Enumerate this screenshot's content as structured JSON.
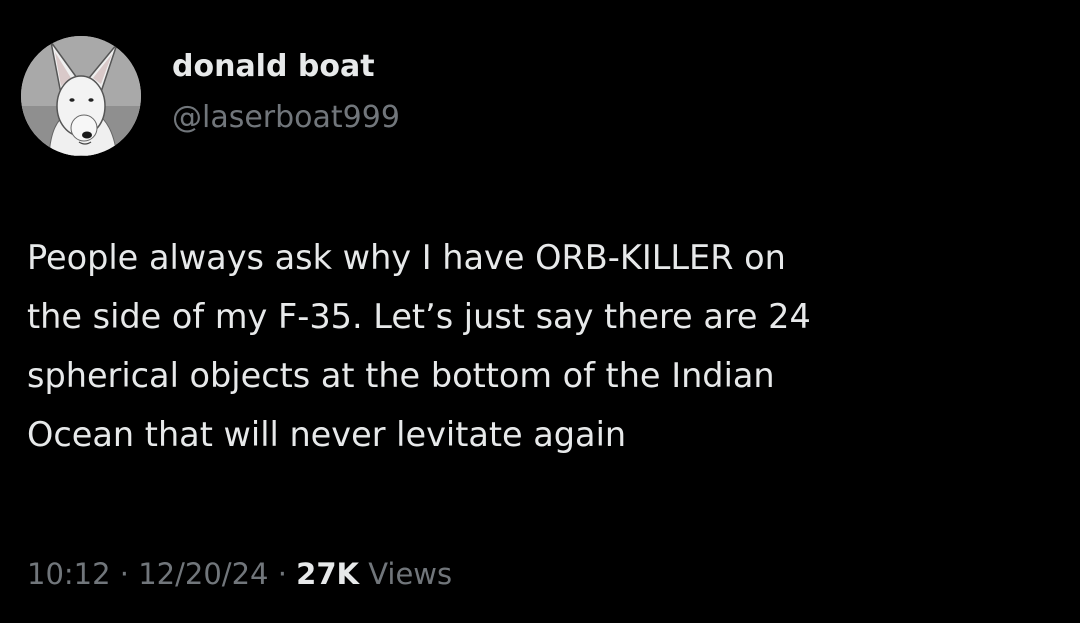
{
  "author": {
    "display_name": "donald boat",
    "handle": "@laserboat999",
    "avatar_icon": "bull-terrier-avatar-icon"
  },
  "tweet": {
    "lines": [
      "People always ask why I have ORB-KILLER on",
      "the side of my F-35. Let’s just say there are 24",
      "spherical objects at the bottom of the Indian",
      "Ocean that will never levitate again"
    ]
  },
  "meta": {
    "time": "10:12",
    "separator": " · ",
    "date": "12/20/24",
    "views_count": "27K",
    "views_label": "Views"
  },
  "colors": {
    "background": "#000000",
    "primary_text": "#e7e9ea",
    "secondary_text": "#71767b"
  }
}
